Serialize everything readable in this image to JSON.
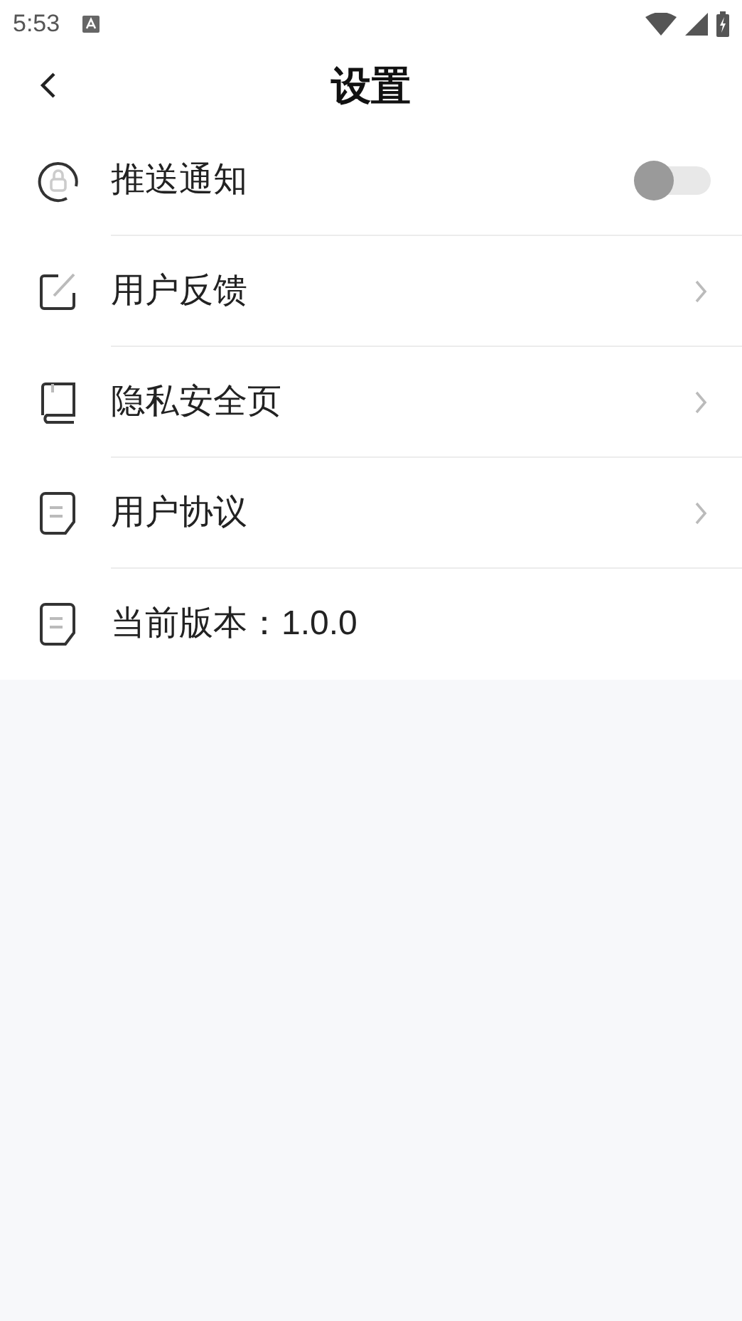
{
  "status_bar": {
    "time": "5:53"
  },
  "header": {
    "title": "设置"
  },
  "items": [
    {
      "kind": "toggle",
      "label": "推送通知",
      "on": false
    },
    {
      "kind": "link",
      "label": "用户反馈"
    },
    {
      "kind": "link",
      "label": "隐私安全页"
    },
    {
      "kind": "link",
      "label": "用户协议"
    },
    {
      "kind": "plain",
      "label": "当前版本：1.0.0"
    }
  ]
}
